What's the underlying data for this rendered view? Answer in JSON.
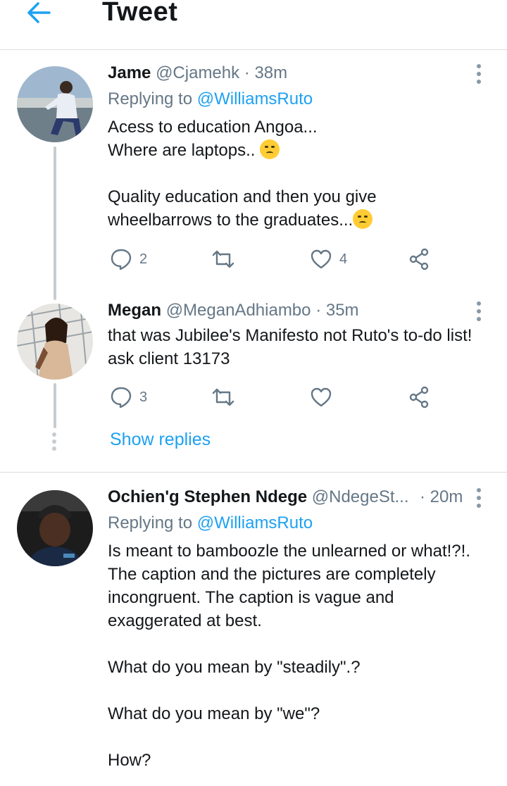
{
  "header": {
    "title": "Tweet"
  },
  "tweets": [
    {
      "name": "Jame",
      "handle": "@Cjamehk",
      "time": "· 38m",
      "replying_prefix": "Replying to ",
      "replying_to": "@WilliamsRuto",
      "lines": [
        "Acess to education Angoa...",
        "Where are laptops.. ",
        "Quality education and then you give",
        "wheelbarrows to the graduates..."
      ],
      "replies": "2",
      "likes": "4"
    },
    {
      "name": "Megan",
      "handle": "@MeganAdhiambo",
      "time": "· 35m",
      "lines": [
        "that was Jubilee's Manifesto not Ruto's to-do list!",
        "ask client 13173"
      ],
      "replies": "3"
    },
    {
      "name": "Ochien'g Stephen Ndege",
      "handle": "@NdegeSt...",
      "time": "· 20m",
      "replying_prefix": "Replying to ",
      "replying_to": "@WilliamsRuto",
      "lines": [
        "Is meant to bamboozle the unlearned or what!?!.",
        "The caption and the pictures are completely",
        "incongruent. The caption is vague and",
        "exaggerated at best.",
        "What do you mean by \"steadily\".?",
        "What do you mean by \"we\"?",
        "How?"
      ]
    }
  ],
  "show_replies": "Show replies",
  "colors": {
    "accent": "#1da1f2",
    "secondary": "#657786",
    "icon": "#657786"
  }
}
